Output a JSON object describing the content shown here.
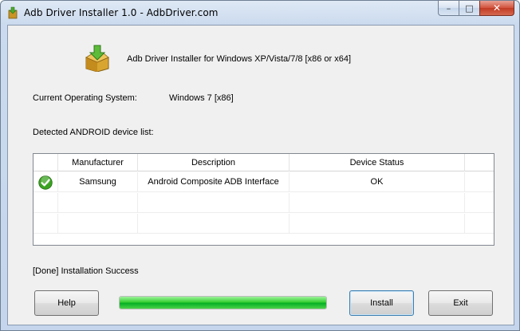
{
  "window": {
    "title": "Adb Driver Installer 1.0   -   AdbDriver.com",
    "minimize_glyph": "–",
    "maximize_glyph": "□",
    "close_glyph": "✕"
  },
  "header": {
    "text": "Adb Driver Installer for Windows XP/Vista/7/8 [x86 or x64]",
    "icon": "installer-box-icon"
  },
  "os": {
    "label": "Current Operating System:",
    "value": "Windows 7  [x86]"
  },
  "device_list": {
    "label": "Detected ANDROID device list:",
    "columns": [
      "",
      "Manufacturer",
      "Description",
      "Device Status"
    ],
    "rows": [
      {
        "icon": "check-ok-icon",
        "manufacturer": "Samsung",
        "description": "Android Composite ADB Interface",
        "status": "OK"
      }
    ]
  },
  "status_text": "[Done] Installation Success",
  "progress": {
    "fraction": 1.0
  },
  "buttons": {
    "help": "Help",
    "install": "Install",
    "exit": "Exit"
  },
  "colors": {
    "progress_green": "#06b025",
    "ok_green": "#3aa321"
  }
}
